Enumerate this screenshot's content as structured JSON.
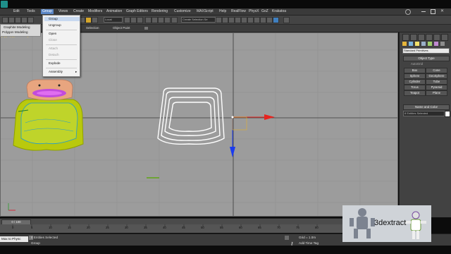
{
  "menubar": {
    "items": [
      "Edit",
      "Tools",
      "Group",
      "Views",
      "Create",
      "Modifiers",
      "Animation",
      "Graph Editors",
      "Rendering",
      "Customize",
      "MAXScript",
      "Help",
      "RealFlow",
      "PhysX",
      "GoZ",
      "Krakatoa"
    ],
    "active_index": 2
  },
  "toolbar": {
    "selection_filter": "Local",
    "named_selection": "Create Selection Se"
  },
  "ribbon": {
    "tabs": [
      "Selection",
      "Object Paint"
    ]
  },
  "graphite_popup": {
    "items": [
      "Graphite Modeling",
      "Polygon Modeling"
    ]
  },
  "group_menu": {
    "items": [
      {
        "label": "Group",
        "enabled": true,
        "selected": true
      },
      {
        "label": "Ungroup",
        "enabled": true,
        "selected": false
      },
      {
        "label": "Open",
        "enabled": true,
        "selected": false
      },
      {
        "label": "Close",
        "enabled": false,
        "selected": false
      },
      {
        "label": "Attach",
        "enabled": false,
        "selected": false
      },
      {
        "label": "Detach",
        "enabled": false,
        "selected": false
      },
      {
        "label": "Explode",
        "enabled": true,
        "selected": false
      },
      {
        "label": "Assembly",
        "enabled": true,
        "selected": false
      }
    ]
  },
  "viewport": {
    "label": "[+] [Top] [ Smooth ]"
  },
  "command_panel": {
    "category": "Standard Primitives",
    "object_type_title": "Object Type",
    "autogrid_label": "AutoGrid",
    "buttons": [
      "Box",
      "Cone",
      "Sphere",
      "GeoSphere",
      "Cylinder",
      "Tube",
      "Torus",
      "Pyramid",
      "Teapot",
      "Plane"
    ],
    "name_color_title": "Name and Color",
    "name_value": "8 Entities Selected"
  },
  "timeline": {
    "frame_display": "0 / 100",
    "ticks": [
      "0",
      "5",
      "10",
      "15",
      "20",
      "25",
      "30",
      "35",
      "40",
      "45",
      "50",
      "55",
      "60",
      "65",
      "70",
      "75",
      "80"
    ]
  },
  "status": {
    "selection_count": "8 Entities Selected",
    "prompt": "Group",
    "grid": "Grid = 1.0m",
    "add_time_tag": "Add Time Tag",
    "listener": "Max to Physc"
  },
  "watermark": {
    "text": "3dextract"
  },
  "colors": {
    "accent": "#5b87c7",
    "viewport_bg": "#9c9c9c",
    "axis_x": "#e8231e",
    "axis_y": "#1a3bf0"
  }
}
